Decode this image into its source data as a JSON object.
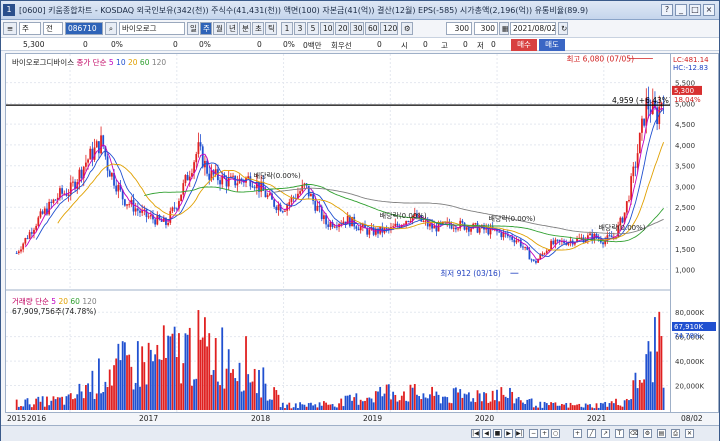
{
  "title_bar": {
    "number": "1",
    "title": "[0600] 키움종합차트 - KOSDAQ 외국인보유(342(천)) 주식수(41,431(천)) 액면(100) 자본금(41(억)) 결산(12월) EPS(-585) 시가총액(2,196(억)) 유통비율(89.9)",
    "buttons": [
      "?",
      "_",
      "□",
      "×"
    ]
  },
  "toolbar": {
    "main_label": "주",
    "prev_label": "전",
    "code": "086710",
    "stock_name": "바이오로그",
    "periods": [
      "일",
      "주",
      "월",
      "년",
      "분",
      "초",
      "틱"
    ],
    "selected_period": "주",
    "intervals": [
      "1",
      "3",
      "5",
      "10",
      "20",
      "30",
      "60",
      "120"
    ],
    "count": "300",
    "count_max": "300",
    "date": "2021/08/02"
  },
  "quote_bar": {
    "price": "5,300",
    "change": "0",
    "change_pct": "0%",
    "c3": "0",
    "c3_pct": "0%",
    "c4": "0",
    "c4_pct": "0%",
    "c5": "0백만",
    "c6": "회우선",
    "c7": "0",
    "c8_label": "시",
    "c8": "0",
    "c9_label": "고",
    "c9": "0",
    "c10_label": "저",
    "c10": "0",
    "buy_label": "매수",
    "sell_label": "매도"
  },
  "price_panel": {
    "name": "바이오로그디바이스",
    "legend_label": "종가 단순",
    "ma_periods": [
      "5",
      "10",
      "20",
      "60",
      "120"
    ],
    "ma_colors": [
      "#c000c0",
      "#2050d0",
      "#e0a000",
      "#30a030",
      "#808080"
    ],
    "max_label": "최고 6,080 (07/05)",
    "min_label": "최저 912 (03/16)",
    "hline_label": "4,959 (+6.43%)",
    "annotations": [
      {
        "text": "배당락(0.00%)",
        "x": 2017.72,
        "y": 3200
      },
      {
        "text": "배당락(0.00%)",
        "x": 2018.9,
        "y": 2240
      },
      {
        "text": "배당락(0.00%)",
        "x": 2019.92,
        "y": 2170
      },
      {
        "text": "배당락(0.00%)",
        "x": 2020.95,
        "y": 1950
      }
    ],
    "right_axis": {
      "lc": "LC:481.14",
      "hc": "HC:-12.83",
      "last_price": "5,300",
      "last_pct": "18.04%",
      "ticks": [
        "5,500",
        "5,000",
        "4,500",
        "4,000",
        "3,500",
        "3,000",
        "2,500",
        "2,000",
        "1,500",
        "1,000"
      ]
    }
  },
  "volume_panel": {
    "legend_label": "거래량 단순",
    "ma_periods": [
      "5",
      "20",
      "60",
      "120"
    ],
    "value_label": "67,909,756주(74.78%)",
    "right_axis": {
      "last_value": "67,910K",
      "last_pct": "74.78%",
      "ticks": [
        "80,000K",
        "60,000K",
        "40,000K",
        "20,000K"
      ]
    }
  },
  "x_axis": {
    "labels": [
      "2015",
      "2016",
      "2017",
      "2018",
      "2019",
      "2020",
      "2021"
    ],
    "right_label": "08/02"
  },
  "chart_data": {
    "type": "candlestick",
    "price": {
      "x": [
        2015.5,
        2015.7,
        2015.9,
        2016.0,
        2016.15,
        2016.3,
        2016.35,
        2016.5,
        2016.7,
        2016.9,
        2017.0,
        2017.2,
        2017.3,
        2017.5,
        2017.7,
        2017.9,
        2018.0,
        2018.2,
        2018.4,
        2018.6,
        2018.8,
        2019.0,
        2019.2,
        2019.4,
        2019.6,
        2019.8,
        2020.0,
        2020.2,
        2020.35,
        2020.5,
        2020.7,
        2020.9,
        2021.0,
        2021.1,
        2021.2,
        2021.3,
        2021.4,
        2021.5,
        2021.56
      ],
      "close": [
        1400,
        2200,
        2800,
        2900,
        3600,
        4100,
        3500,
        2700,
        2300,
        2100,
        2600,
        3900,
        3300,
        3100,
        3200,
        2600,
        2500,
        3000,
        2100,
        2200,
        1900,
        1950,
        2300,
        2000,
        2100,
        2000,
        1900,
        1700,
        1150,
        1600,
        1700,
        1800,
        1700,
        1800,
        2400,
        3600,
        5000,
        4700,
        5300
      ],
      "high_label": 6080,
      "low_label": 912,
      "ylim": [
        700,
        5900
      ]
    },
    "volume": {
      "x": [
        2015.5,
        2016.0,
        2016.35,
        2017.2,
        2017.6,
        2018.0,
        2018.5,
        2019.0,
        2019.5,
        2020.0,
        2020.4,
        2020.9,
        2021.2,
        2021.4,
        2021.52,
        2021.56
      ],
      "values": [
        8000,
        12000,
        45000,
        72000,
        60000,
        5000,
        8000,
        22000,
        15000,
        20000,
        6000,
        5000,
        10000,
        48000,
        90000,
        67910
      ],
      "ylim": [
        0,
        90000
      ]
    }
  }
}
